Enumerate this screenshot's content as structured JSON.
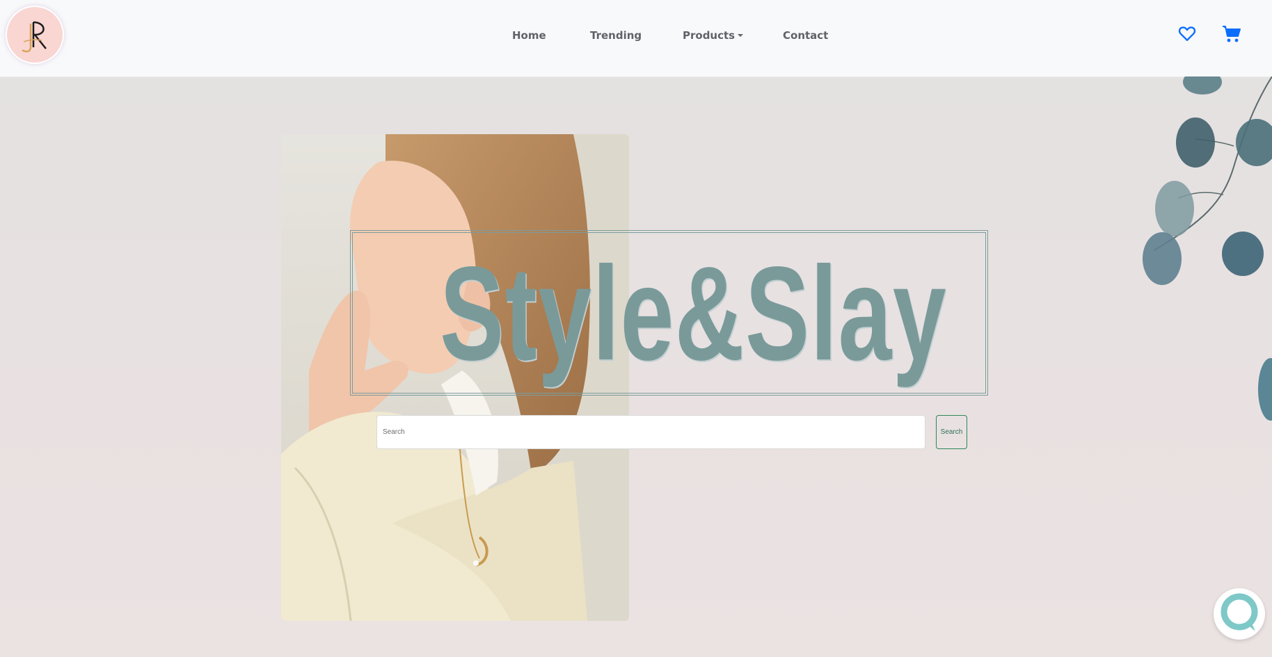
{
  "brand": {
    "logo_monogram": "JR",
    "logo_colors": {
      "background": "#f9d6d2",
      "letters": "#1c1c1c",
      "accent": "#d9a35b"
    }
  },
  "nav": {
    "links": [
      {
        "label": "Home"
      },
      {
        "label": "Trending"
      },
      {
        "label": "Products",
        "has_dropdown": true
      },
      {
        "label": "Contact"
      }
    ],
    "icons": [
      "heart-icon",
      "cart-icon"
    ],
    "icon_color": "#0d6efd"
  },
  "hero": {
    "title": "Style&Slay",
    "title_color": "#7a9a9a"
  },
  "search": {
    "placeholder": "Search",
    "value": "",
    "button_label": "Search",
    "button_color": "#2d8659"
  },
  "chat": {
    "icon": "chat-bubble-icon",
    "color": "#7ec8c8"
  }
}
